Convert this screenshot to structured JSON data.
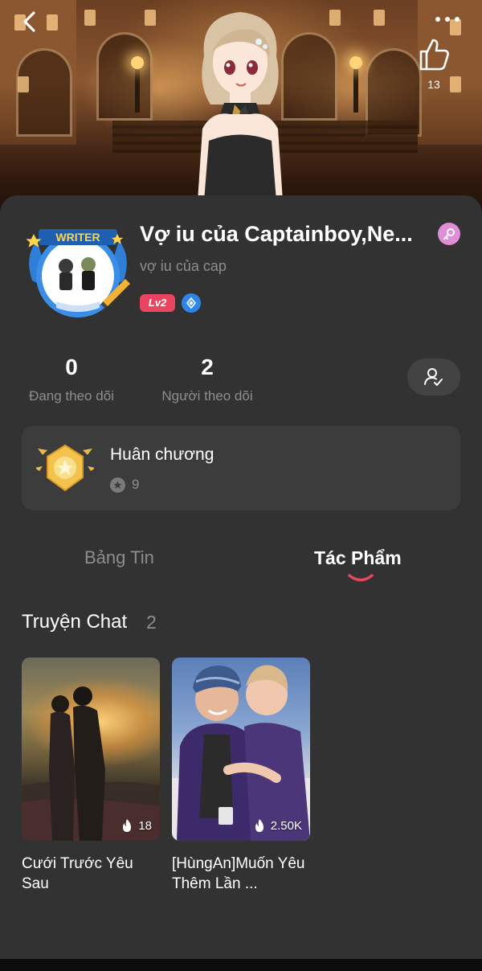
{
  "header": {
    "like_count": "13"
  },
  "profile": {
    "username": "Vợ iu của Captainboy,Ne...",
    "bio": "vợ iu của cap",
    "level_badge": "Lv2",
    "badge_text_top": "WRITER"
  },
  "stats": {
    "following_count": "0",
    "following_label": "Đang theo dõi",
    "followers_count": "2",
    "followers_label": "Người theo dõi"
  },
  "medal": {
    "title": "Huân chương",
    "count": "9"
  },
  "tabs": [
    {
      "label": "Bảng Tin",
      "active": false
    },
    {
      "label": "Tác Phẩm",
      "active": true
    }
  ],
  "section": {
    "title": "Truyện Chat",
    "count": "2"
  },
  "stories": [
    {
      "title": "Cưới Trước Yêu Sau",
      "reads": "18"
    },
    {
      "title": "[HùngAn]Muốn Yêu Thêm Lần ...",
      "reads": "2.50K"
    }
  ],
  "colors": {
    "sheet_bg": "#323232",
    "card_bg": "#3c3c3c",
    "accent_pink": "#e94560",
    "muted_text": "#8d8d8d"
  }
}
